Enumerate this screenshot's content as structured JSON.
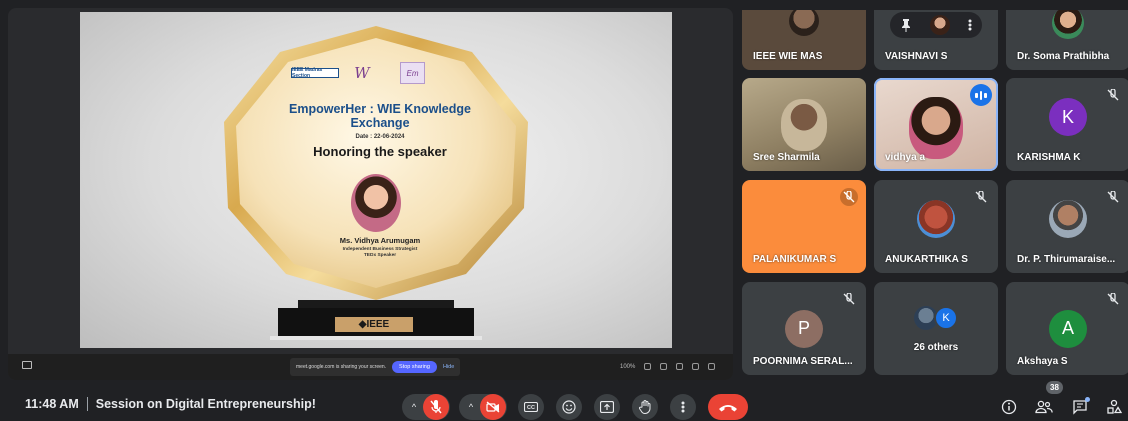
{
  "shared_screen": {
    "slide": {
      "logos": {
        "ieee_madras": "IEEE Madras Section",
        "wie": "W",
        "empower": "Em"
      },
      "event_title": "EmpowerHer : WIE Knowledge Exchange",
      "date": "Date : 22-06-2024",
      "heading": "Honoring the speaker",
      "speaker_name": "Ms. Vidhya Arumugam",
      "speaker_role_1": "Independent Business Strategist",
      "speaker_role_2": "TEDx Speaker",
      "plaque_text": "◆IEEE"
    },
    "notice": {
      "message": "meet.google.com is sharing your screen.",
      "stop_label": "Stop sharing",
      "hide_label": "Hide"
    },
    "zoom_level": "100%"
  },
  "participants": [
    {
      "name": "IEEE WIE MAS"
    },
    {
      "name": "VAISHNAVI S"
    },
    {
      "name": "Dr. Soma Prathibha"
    },
    {
      "name": "Sree Sharmila"
    },
    {
      "name": "vidhya a"
    },
    {
      "name": "KARISHMA K",
      "initial": "K"
    },
    {
      "name": "PALANIKUMAR S"
    },
    {
      "name": "ANUKARTHIKA S"
    },
    {
      "name": "Dr. P. Thirumaraise..."
    },
    {
      "name": "POORNIMA SERAL...",
      "initial": "P"
    },
    {
      "name": "26 others",
      "initial": "K"
    },
    {
      "name": "Akshaya S",
      "initial": "A"
    }
  ],
  "bottom_bar": {
    "time": "11:48 AM",
    "meeting_title": "Session on Digital Entrepreneurship!",
    "people_count": "38"
  },
  "colors": {
    "background": "#202124",
    "tile": "#3c4043",
    "danger": "#ea4335",
    "accent_orange": "#fb8c3c",
    "avatar_purple": "#7b2fbf",
    "avatar_brown": "#8d6e63",
    "avatar_green": "#1e8e3e"
  }
}
